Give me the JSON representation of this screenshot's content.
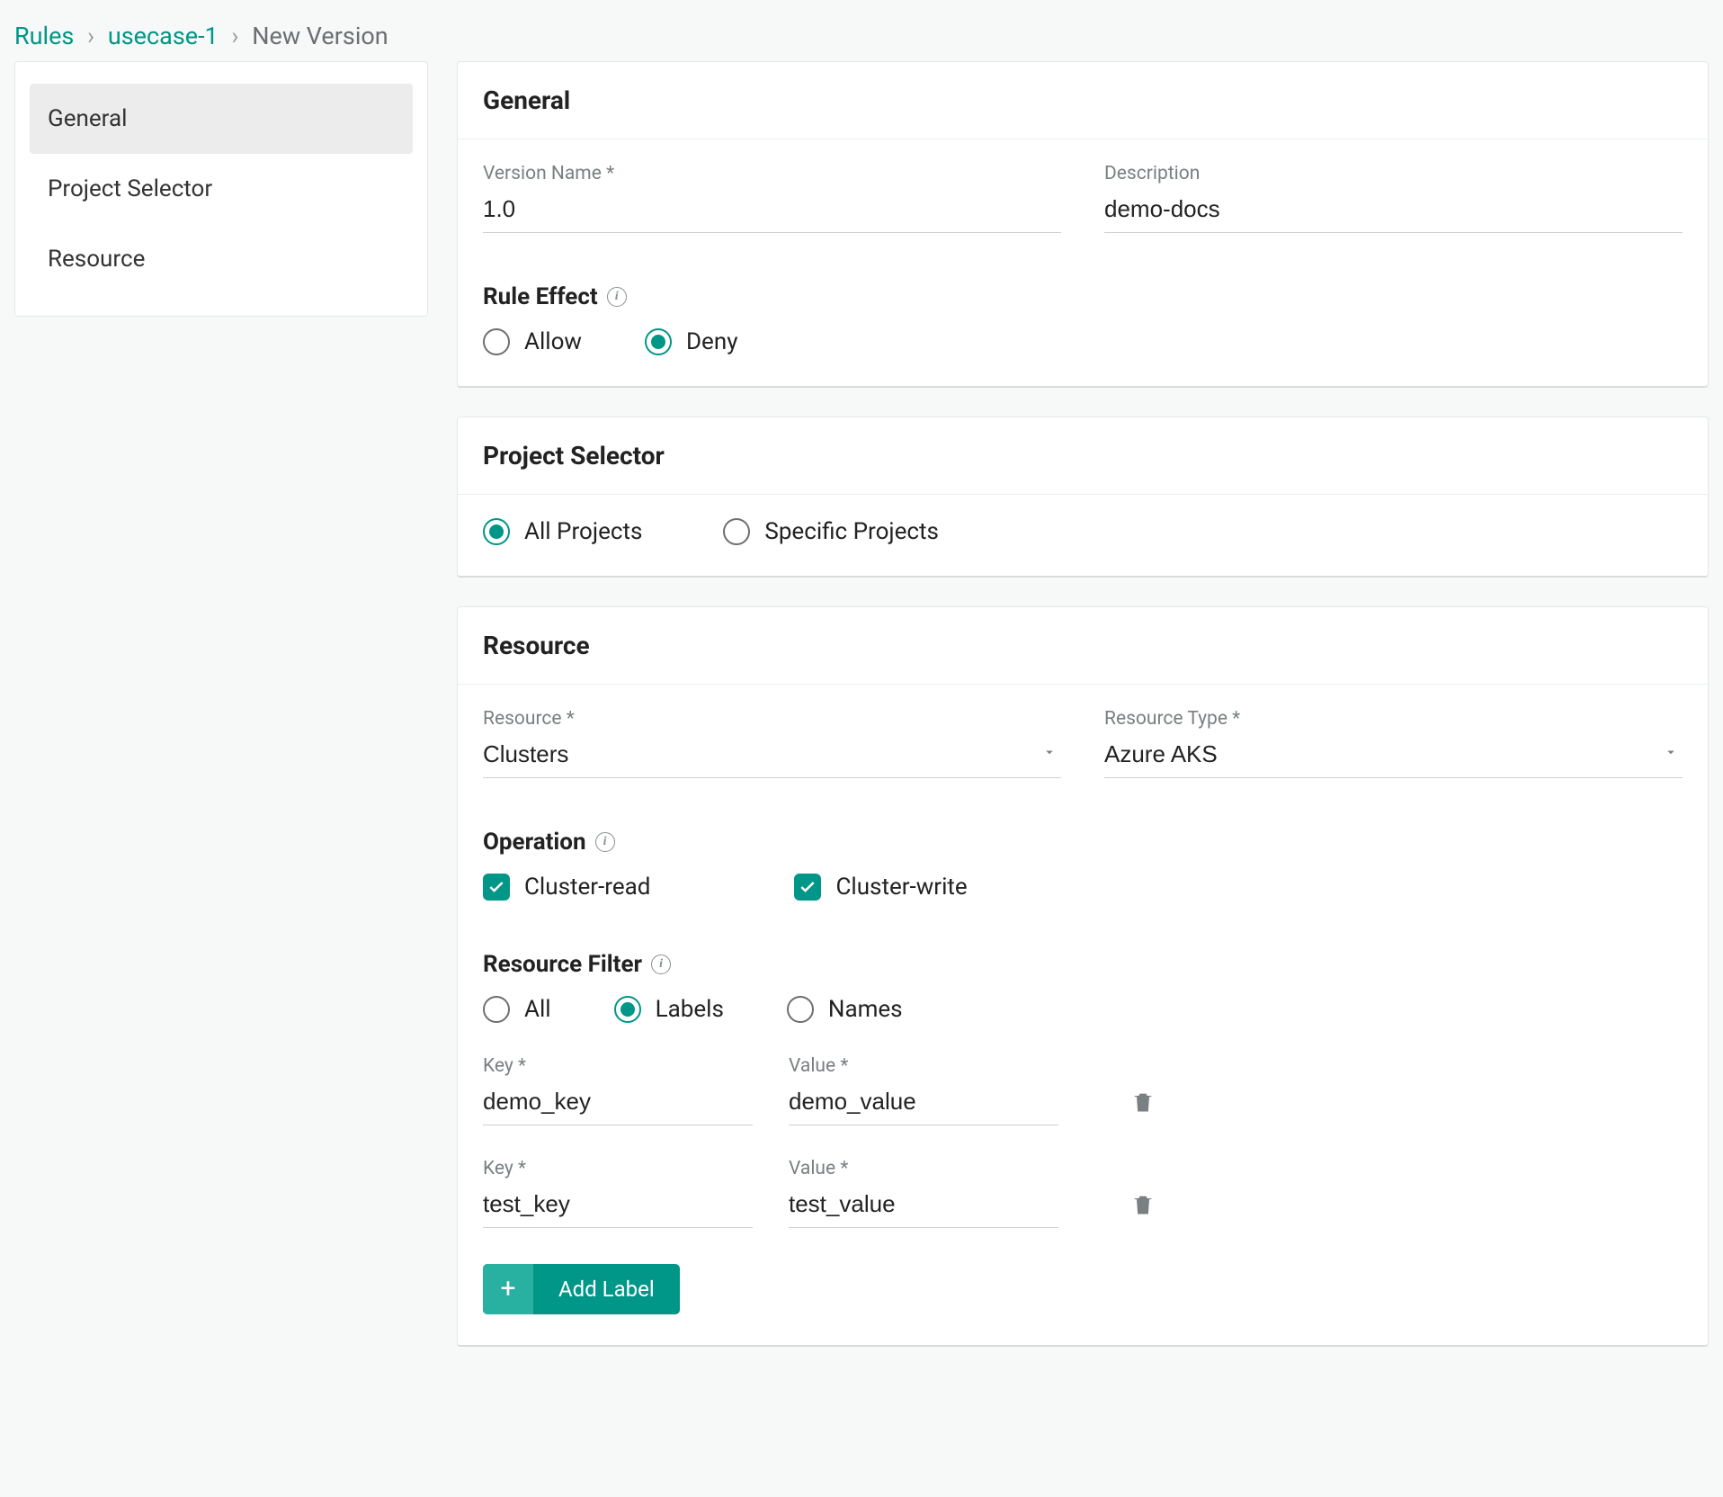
{
  "breadcrumb": {
    "root": "Rules",
    "mid": "usecase-1",
    "current": "New Version"
  },
  "sidebar": {
    "items": [
      {
        "label": "General",
        "active": true
      },
      {
        "label": "Project Selector",
        "active": false
      },
      {
        "label": "Resource",
        "active": false
      }
    ]
  },
  "general": {
    "title": "General",
    "versionName": {
      "label": "Version Name *",
      "value": "1.0"
    },
    "description": {
      "label": "Description",
      "value": "demo-docs"
    },
    "ruleEffect": {
      "label": "Rule Effect",
      "options": {
        "allow": "Allow",
        "deny": "Deny"
      },
      "selected": "deny"
    }
  },
  "projectSelector": {
    "title": "Project Selector",
    "options": {
      "all": "All Projects",
      "specific": "Specific Projects"
    },
    "selected": "all"
  },
  "resource": {
    "title": "Resource",
    "resourceSel": {
      "label": "Resource *",
      "value": "Clusters"
    },
    "resourceType": {
      "label": "Resource Type *",
      "value": "Azure AKS"
    },
    "operation": {
      "label": "Operation",
      "items": [
        {
          "label": "Cluster-read",
          "checked": true
        },
        {
          "label": "Cluster-write",
          "checked": true
        }
      ]
    },
    "filter": {
      "label": "Resource Filter",
      "options": {
        "all": "All",
        "labels": "Labels",
        "names": "Names"
      },
      "selected": "labels"
    },
    "labels": [
      {
        "keyLabel": "Key *",
        "key": "demo_key",
        "valueLabel": "Value *",
        "value": "demo_value"
      },
      {
        "keyLabel": "Key *",
        "key": "test_key",
        "valueLabel": "Value *",
        "value": "test_value"
      }
    ],
    "addLabel": "Add Label"
  }
}
